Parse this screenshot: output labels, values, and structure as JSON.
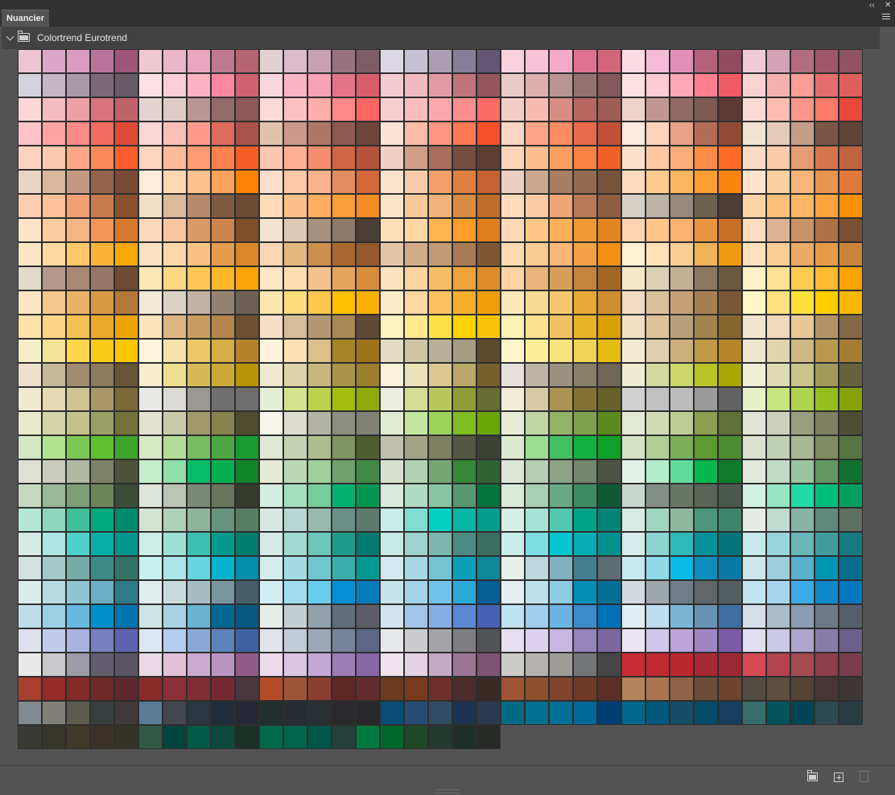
{
  "panel": {
    "tab_label": "Nuancier",
    "collapse_glyph": "‹‹",
    "close_glyph": "✕",
    "group_label": "Colortrend Eurotrend"
  },
  "icons": {
    "collapse": "double-chevron-left-icon",
    "close": "close-icon",
    "menu": "panel-menu-icon",
    "group_toggle": "chevron-down-icon",
    "group_folder": "folder-icon",
    "new_group": "new-folder-icon",
    "new_swatch": "new-swatch-icon",
    "delete": "trash-icon"
  },
  "swatches": [
    [
      "#ecc4d2",
      "#dca7c6",
      "#d99bc1",
      "#b8739a",
      "#9e5578",
      "#f0c8d2",
      "#e9b7c9",
      "#e8a6bf",
      "#c17891",
      "#b6646f",
      "#e3d0d3",
      "#dcbccb",
      "#c7a2b3",
      "#99727f",
      "#7d5c67",
      "#dcd8e3",
      "#c7c1d6",
      "#aa9db5",
      "#867d99",
      "#635674",
      "#fad2de",
      "#fbc2d7",
      "#f4abc9",
      "#de7391",
      "#d16579",
      "#fbdbe4",
      "#f6bcd5",
      "#e28eb7",
      "#b4627b",
      "#914c60",
      "#f0cad7",
      "#d3a2b4",
      "#b36c80",
      "#9f5669",
      "#8e5260"
    ],
    [
      "#d4d2db",
      "#c3b7c3",
      "#a79aa6",
      "#7a6a78",
      "#685b67",
      "#fde1e6",
      "#fbcdd7",
      "#fdb3c4",
      "#fb889f",
      "#cf6171",
      "#fbd6de",
      "#fbb5c6",
      "#f6a2b6",
      "#e47388",
      "#d85d6a",
      "#f4cbd0",
      "#f1bac2",
      "#e39ba3",
      "#c1737a",
      "#94565c",
      "#e8cac7",
      "#dcaeac",
      "#b99494",
      "#967071",
      "#82585c",
      "#fee1e3",
      "#fdcbd5",
      "#fda9b8",
      "#fd8090",
      "#f05b63",
      "#f9d3d2",
      "#f3b2ad",
      "#fe9c96",
      "#e56e6c",
      "#e1605d"
    ],
    [
      "#fbd7da",
      "#f6bbc2",
      "#eda1a6",
      "#d7747c",
      "#c1626a",
      "#e5d3d2",
      "#dfcac7",
      "#b99594",
      "#936b6b",
      "#8c5957",
      "#fdd9d9",
      "#fdc1c1",
      "#feacac",
      "#fe8885",
      "#fe6663",
      "#f4cfcf",
      "#f9bcbd",
      "#fba7ac",
      "#fc8e8f",
      "#fa6b67",
      "#f3cdc6",
      "#f7bbb1",
      "#d88c85",
      "#b86661",
      "#9e5d55",
      "#eed3cb",
      "#bf9991",
      "#916a63",
      "#7d5b53",
      "#5d3a34",
      "#fcdad4",
      "#fcbcb0",
      "#fd968a",
      "#fb7a68",
      "#e8493a"
    ],
    [
      "#fdc3c6",
      "#fea3a3",
      "#fb8a86",
      "#f26c5f",
      "#e04c38",
      "#fcd6d4",
      "#fabfb8",
      "#fe9b8d",
      "#de6b5e",
      "#a9534b",
      "#e0c2ac",
      "#cc9a8c",
      "#ad7868",
      "#8e5a50",
      "#6e443b",
      "#fde3d5",
      "#fdbca8",
      "#fd967f",
      "#fd7956",
      "#f44e2a",
      "#fdd5c5",
      "#fea588",
      "#fd8b63",
      "#e96a48",
      "#c25038",
      "#feeadf",
      "#fdd2bd",
      "#e9a288",
      "#b56c56",
      "#944b36",
      "#f2e2d2",
      "#e4cab9",
      "#c39e89",
      "#7b5647",
      "#5f4336"
    ],
    [
      "#fdd2bf",
      "#fec8ac",
      "#fea788",
      "#fb8a5a",
      "#fc5d2f",
      "#fed4bf",
      "#fdbb99",
      "#fd9c73",
      "#fe824d",
      "#f65e28",
      "#fec6af",
      "#fdad90",
      "#f28e6d",
      "#d06545",
      "#b5523b",
      "#efd0c2",
      "#d19c88",
      "#a86d5b",
      "#774d3f",
      "#5c3e33",
      "#fdd4b7",
      "#fdbd8e",
      "#fc9e61",
      "#f88342",
      "#f16125",
      "#fbe0cc",
      "#fdc7a4",
      "#fdad7a",
      "#fe8c46",
      "#fb6b24",
      "#fcdbc6",
      "#fdcaaa",
      "#e49d73",
      "#d6744b",
      "#c06241"
    ],
    [
      "#ead5c4",
      "#dbb7a0",
      "#c49984",
      "#94634c",
      "#7a4a36",
      "#feebd9",
      "#fdd7b2",
      "#fdc08f",
      "#fda15b",
      "#fd8103",
      "#fcdecf",
      "#fec8a8",
      "#f9b38b",
      "#e28d5e",
      "#d3683a",
      "#fce3cd",
      "#f8ccaa",
      "#f29f68",
      "#e07f3e",
      "#c46231",
      "#e9d0c0",
      "#cba78f",
      "#a77d63",
      "#936a50",
      "#7a533c",
      "#fedbbe",
      "#fdcb8c",
      "#fdb660",
      "#fd9e31",
      "#fd8410",
      "#fee4cf",
      "#fdcf9f",
      "#f7b57a",
      "#ea944e",
      "#df7839"
    ],
    [
      "#fdceb1",
      "#fdc19a",
      "#f1a072",
      "#c87a4f",
      "#8b4f2e",
      "#f2dfc7",
      "#d9bb9b",
      "#b58b6c",
      "#7e5a41",
      "#6c4a33",
      "#fedab9",
      "#fec089",
      "#fdae61",
      "#f99d3b",
      "#f38c24",
      "#fce4cd",
      "#f9ca97",
      "#f2b379",
      "#d98b3f",
      "#bf6c2a",
      "#fddbbb",
      "#fcc9a2",
      "#f0a575",
      "#b87b55",
      "#8e5f41",
      "#d6d0c4",
      "#bdb4a5",
      "#958a7c",
      "#6d6150",
      "#4b3f36",
      "#fdd3a4",
      "#fdc07c",
      "#fdb764",
      "#fda53c",
      "#fd9006"
    ],
    [
      "#fee5c9",
      "#fdcba0",
      "#f8b584",
      "#f19657",
      "#d6792f",
      "#fed8bb",
      "#f9c6a1",
      "#d89a69",
      "#cd844d",
      "#804f2a",
      "#f4e2d0",
      "#dec9b4",
      "#a69080",
      "#8d7a6a",
      "#4b3f36",
      "#fedfb8",
      "#fed7a4",
      "#ffb452",
      "#fe9e28",
      "#e07e1b",
      "#fdd8b6",
      "#fdc686",
      "#fbb25a",
      "#f09a35",
      "#e28420",
      "#fed4b0",
      "#fec48a",
      "#fbb170",
      "#e99443",
      "#c86f26",
      "#fddcc0",
      "#dcb495",
      "#c99266",
      "#ad7246",
      "#7b4f31"
    ],
    [
      "#fbe7c5",
      "#fcd9a0",
      "#fec86a",
      "#fcb239",
      "#fca807",
      "#fee2c4",
      "#fdd7a8",
      "#fbc382",
      "#e59c4d",
      "#d9892a",
      "#f9d5b3",
      "#e5b67f",
      "#ca8e4d",
      "#a8682f",
      "#95592d",
      "#e2c5a6",
      "#d2ac88",
      "#c29a73",
      "#a97b55",
      "#7f5833",
      "#fedab0",
      "#fbc992",
      "#f9b677",
      "#f4a148",
      "#f49013",
      "#fef0d4",
      "#fde2b9",
      "#f8ce94",
      "#f0b356",
      "#f19c0e",
      "#fde0bc",
      "#fdcb96",
      "#e9ab65",
      "#e69b48",
      "#c98638"
    ],
    [
      "#e3d9c8",
      "#b4998a",
      "#a78873",
      "#967566",
      "#6f4c34",
      "#fde8b8",
      "#fdd784",
      "#fec755",
      "#feb62b",
      "#fca30b",
      "#fee7c5",
      "#fedeb0",
      "#f4c48e",
      "#e7a45e",
      "#d88d3d",
      "#fde4be",
      "#fdd49f",
      "#f8bd67",
      "#f0a13a",
      "#db8b28",
      "#fdd3a3",
      "#e8b47c",
      "#d79e5b",
      "#c4843c",
      "#a36826",
      "#f7e7ca",
      "#dad0b6",
      "#c2b195",
      "#8c7861",
      "#6b5841",
      "#fff1c7",
      "#fee294",
      "#ffcb51",
      "#ffba31",
      "#fea305"
    ],
    [
      "#fee6c4",
      "#f6c68e",
      "#e8b365",
      "#d99942",
      "#b47939",
      "#f2e9d7",
      "#dad3c4",
      "#c2b2a3",
      "#958372",
      "#6d6156",
      "#fde7ae",
      "#fddc7b",
      "#fec64b",
      "#ffc004",
      "#fcb003",
      "#feebc7",
      "#fdd7a2",
      "#fec15f",
      "#fab02b",
      "#f29e0a",
      "#fde9b8",
      "#f9da92",
      "#f4c86e",
      "#e7a734",
      "#ce8e2d",
      "#f0dac3",
      "#d8bf9b",
      "#c6a177",
      "#a68053",
      "#7b5936",
      "#fef6c7",
      "#fee17e",
      "#fee03b",
      "#fece03",
      "#fdb704"
    ],
    [
      "#fde2aa",
      "#fcd588",
      "#f5c152",
      "#eca929",
      "#eea604",
      "#fde5bb",
      "#deb682",
      "#c99c61",
      "#b2864c",
      "#6d5132",
      "#f4dfc6",
      "#d4bd98",
      "#b29772",
      "#a88854",
      "#604a35",
      "#fdf1bf",
      "#fee98d",
      "#fee048",
      "#fed303",
      "#fcc207",
      "#fef1b4",
      "#fce191",
      "#eec262",
      "#e9b329",
      "#d9a007",
      "#f0dfc3",
      "#dec39a",
      "#b8a07a",
      "#a1854f",
      "#86662f",
      "#f2e4d0",
      "#efd9ba",
      "#e8c896",
      "#b39266",
      "#826845"
    ],
    [
      "#f7efc8",
      "#f2e396",
      "#fed74d",
      "#fdca1b",
      "#fec704",
      "#fdf4dc",
      "#f6e3ac",
      "#ebc767",
      "#d4ae45",
      "#b4822d",
      "#fef3dc",
      "#fce2b2",
      "#dbc089",
      "#a78428",
      "#9e741b",
      "#e3dbc3",
      "#cec3a5",
      "#b8b19a",
      "#a59c84",
      "#5d4b30",
      "#fef5c8",
      "#fdee99",
      "#f6e37b",
      "#f0d455",
      "#e2bb13",
      "#f3ead2",
      "#dfcfb0",
      "#cdaf7c",
      "#c09a44",
      "#b48629",
      "#ede6cf",
      "#e0d4ad",
      "#cfb883",
      "#b8994f",
      "#a47c36"
    ],
    [
      "#ede1cd",
      "#c8b89c",
      "#9f8b70",
      "#8d7a5d",
      "#675535",
      "#f5edcd",
      "#ece08e",
      "#d7b957",
      "#cca937",
      "#b89305",
      "#f0e9d1",
      "#ddd1a8",
      "#c6b77c",
      "#a99349",
      "#9a7f2c",
      "#faf2d8",
      "#ebe1b8",
      "#dbc78f",
      "#baa966",
      "#76612a",
      "#e6e1dc",
      "#bdb4a6",
      "#9b9180",
      "#888068",
      "#716558",
      "#edebd2",
      "#d3d99c",
      "#cbd769",
      "#b9c226",
      "#a8a705",
      "#f1efd8",
      "#dedbb3",
      "#c9c58a",
      "#a19b5b",
      "#66623d"
    ],
    [
      "#f1e9d2",
      "#e6d9b3",
      "#d0c293",
      "#a99665",
      "#7c6838",
      "#e8e8e7",
      "#dbdad5",
      "#9b9893",
      "#717071",
      "#6e6e6e",
      "#e5efd5",
      "#d5e48a",
      "#bbd24c",
      "#a3be0a",
      "#90a80a",
      "#ecefe0",
      "#d5dd95",
      "#b9c75f",
      "#8f9c38",
      "#666d32",
      "#f1edd8",
      "#d8c9a4",
      "#ab9452",
      "#847235",
      "#66612b",
      "#d1d1d1",
      "#c0c0c0",
      "#bbbbbb",
      "#9a9a9a",
      "#626262",
      "#e7f1c6",
      "#c7e581",
      "#afd44e",
      "#97be20",
      "#86a10b"
    ],
    [
      "#e9e9cc",
      "#d3d4a8",
      "#c3c08a",
      "#99a064",
      "#72723a",
      "#e3e2cf",
      "#cac9a9",
      "#a09a6b",
      "#86824d",
      "#4d4c2e",
      "#f6f5e8",
      "#dcdcd0",
      "#b2b2a5",
      "#8c8e80",
      "#818177",
      "#e1edd1",
      "#c4e5a0",
      "#9ad35a",
      "#7ebe24",
      "#6aa706",
      "#e9ecd6",
      "#bfd6a2",
      "#93b468",
      "#7ea24c",
      "#5d8a1c",
      "#e4e9d4",
      "#d0dbb6",
      "#bdcc94",
      "#8d9d52",
      "#5f7138",
      "#e2e4d5",
      "#cdd1bc",
      "#9a9d7d",
      "#7d7f60",
      "#4d4d35"
    ],
    [
      "#d1e8c2",
      "#b0e38f",
      "#7dc854",
      "#5ec130",
      "#40a42b",
      "#d6e8c4",
      "#b3dc99",
      "#78bc62",
      "#4aa742",
      "#189c2f",
      "#e0e8d6",
      "#c5d2b2",
      "#aebd90",
      "#819462",
      "#505d30",
      "#c1c0ad",
      "#a3a287",
      "#7e7f60",
      "#545742",
      "#3b4133",
      "#dbe9ce",
      "#99dd91",
      "#41bf61",
      "#12b140",
      "#0ea127",
      "#d5e3c4",
      "#b2cd96",
      "#7cad58",
      "#5c9a33",
      "#4d8c33",
      "#dae2cf",
      "#c1cfb2",
      "#a8b794",
      "#7e8b63",
      "#557441"
    ],
    [
      "#dfe0d3",
      "#c9ccbb",
      "#b1b8a1",
      "#7d8266",
      "#4c533a",
      "#c4edc9",
      "#8fdfaa",
      "#03be66",
      "#06b04e",
      "#12842a",
      "#e6ebd8",
      "#bcd9b5",
      "#a0cf9c",
      "#6ea26a",
      "#438946",
      "#d5e1cd",
      "#b1d1b3",
      "#75a775",
      "#37863a",
      "#2f6432",
      "#dbe6d6",
      "#b5ccb0",
      "#8ba285",
      "#74866b",
      "#4c5343",
      "#e1f3e5",
      "#b3edcb",
      "#5edb9b",
      "#06b64f",
      "#0d7d2b",
      "#e1e9db",
      "#c1dac6",
      "#9bc3a0",
      "#609862",
      "#117030"
    ],
    [
      "#c5d9c1",
      "#9ab996",
      "#7d9d77",
      "#6a8658",
      "#3d4c36",
      "#dde6da",
      "#bac5b6",
      "#7b8874",
      "#68745c",
      "#353c2c",
      "#d5ede0",
      "#a3dfbf",
      "#74cd9b",
      "#05b06f",
      "#059751",
      "#d7eadb",
      "#b1dac2",
      "#86c6a2",
      "#589871",
      "#06733b",
      "#d9ebd8",
      "#a8cfb2",
      "#6ba884",
      "#3d8d62",
      "#0e5933",
      "#c5d6cc",
      "#848f87",
      "#6a7766",
      "#5a6557",
      "#4b5a4c",
      "#d1f1e2",
      "#94e6c5",
      "#21d9a3",
      "#05bd7b",
      "#049f5e"
    ],
    [
      "#b5e6d6",
      "#8ed7be",
      "#40bf9a",
      "#03aa7c",
      "#00896a",
      "#d3e3d2",
      "#aed0b8",
      "#8fb39c",
      "#68937c",
      "#587f62",
      "#d6e7e2",
      "#b9d7d2",
      "#9ab9ae",
      "#6a8f87",
      "#5d7b6f",
      "#c8ece7",
      "#7fddd1",
      "#03d1c5",
      "#07b6a4",
      "#009d8c",
      "#d6efe7",
      "#a5e2d6",
      "#54c8af",
      "#01a486",
      "#048374",
      "#d7ece4",
      "#a0d6c1",
      "#90b8a1",
      "#4d957b",
      "#3f846c",
      "#e4ece5",
      "#bedccf",
      "#88b4a6",
      "#5d8a7b",
      "#5e7060"
    ],
    [
      "#d7ebe6",
      "#abe6e1",
      "#4ed1cd",
      "#03afa7",
      "#01958d",
      "#cdeee7",
      "#9ee0d6",
      "#3dc0b3",
      "#01998b",
      "#007d6c",
      "#d5e9e7",
      "#9edacf",
      "#6bc7bb",
      "#1f9b8b",
      "#007b6d",
      "#c7e8e4",
      "#9ed2cc",
      "#7cb6ac",
      "#4c8a83",
      "#3d6f62",
      "#c9ede8",
      "#7cdde2",
      "#03c6d0",
      "#04acb3",
      "#00918e",
      "#d6ecea",
      "#8dd3d0",
      "#2fb8b8",
      "#06929b",
      "#04757b",
      "#c5e8ea",
      "#96d5d9",
      "#68b6b8",
      "#3e9c9c",
      "#157b7e"
    ],
    [
      "#d1e1e0",
      "#a3cac8",
      "#76aca8",
      "#3c8b86",
      "#357367",
      "#c7f0ef",
      "#ace4ea",
      "#65d4df",
      "#04b4cd",
      "#038dad",
      "#d4edec",
      "#a5dce4",
      "#6ec7cf",
      "#3aaeae",
      "#039890",
      "#d2eaef",
      "#a6d8e3",
      "#73c4d3",
      "#0b9fb8",
      "#0e8897",
      "#e7f0ea",
      "#bcd8dc",
      "#83b0bf",
      "#437f8e",
      "#5c6d74",
      "#c7eaee",
      "#8fd9e9",
      "#06bbe4",
      "#0c8dbd",
      "#0879a5",
      "#cde6ea",
      "#9bcdda",
      "#5ab1cb",
      "#0094b2",
      "#096d8d"
    ],
    [
      "#dbeced",
      "#b7dae1",
      "#90c5d4",
      "#6aafc3",
      "#2f7a86",
      "#e0eeed",
      "#c8dcdd",
      "#a6bdc2",
      "#7895a0",
      "#465e6a",
      "#d3eff4",
      "#a1dcf1",
      "#68cdee",
      "#0391d6",
      "#067bbb",
      "#c7e3ea",
      "#a4d3e7",
      "#70c4e9",
      "#2ba9d7",
      "#045e93",
      "#e3eff0",
      "#bce1ec",
      "#8ccde3",
      "#068eb9",
      "#056e96",
      "#d3d9dc",
      "#9ea8ac",
      "#6f7e86",
      "#5e6769",
      "#545e61",
      "#c0e5f0",
      "#a8d3ef",
      "#3bace5",
      "#0e88cb",
      "#0277bd"
    ],
    [
      "#bedeeb",
      "#9ad0e3",
      "#68b9df",
      "#0090c9",
      "#0173af",
      "#cee3e4",
      "#a9d2e3",
      "#68b2d2",
      "#006991",
      "#075982",
      "#e7eee8",
      "#c5ced1",
      "#91a2ad",
      "#606e7b",
      "#5c5d66",
      "#d3e4ef",
      "#a2c6e7",
      "#85aee5",
      "#5b88d3",
      "#4461b5",
      "#c0e1ef",
      "#9fcdea",
      "#6db3e2",
      "#3c8bcb",
      "#0071b7",
      "#e1eff4",
      "#c0ddef",
      "#7ab5d6",
      "#6791b3",
      "#3c6ea2",
      "#d5dfe8",
      "#abbcca",
      "#8b9cb3",
      "#6d7888",
      "#555f6b"
    ],
    [
      "#e0e1ee",
      "#c3cbec",
      "#aab2e0",
      "#7780c0",
      "#5d62ae",
      "#dae8f3",
      "#b5cdef",
      "#8aa9d8",
      "#5d81bd",
      "#3f61a0",
      "#e0e4e8",
      "#c3cbd6",
      "#9ea8b9",
      "#76849b",
      "#5b6784",
      "#e6e8ea",
      "#cbcccf",
      "#a4a4a9",
      "#7f7d84",
      "#525357",
      "#e6e0f1",
      "#dcd1ee",
      "#c7b7e0",
      "#9485bd",
      "#7d67a0",
      "#ece6f4",
      "#d0c6ea",
      "#bba5d8",
      "#9f85c3",
      "#7c5ba6",
      "#e1def0",
      "#cbc9e6",
      "#aea5cc",
      "#887daa",
      "#6b5e8a"
    ],
    [
      "#e9e9e9",
      "#c9c9cd",
      "#9d9ba6",
      "#625e6d",
      "#5a5463",
      "#ebd8e5",
      "#e1c0d8",
      "#ccabd3",
      "#ba94c0",
      "#905a89",
      "#ecdaea",
      "#dbc5e2",
      "#c5a9d5",
      "#9e7cb6",
      "#8966a6",
      "#efe3ee",
      "#e4d1e3",
      "#c6a9c6",
      "#9b7594",
      "#7d5473",
      "#cccbc8",
      "#b4b2ae",
      "#9f9c97",
      "#747576",
      "#464646",
      "#c62d34",
      "#c02832",
      "#bd282f",
      "#a72834",
      "#9c2732",
      "#d84955",
      "#b4424e",
      "#a44a50",
      "#8d3d4b",
      "#793d4e"
    ],
    [
      "#a8402f",
      "#952b27",
      "#822a27",
      "#6e2a25",
      "#5f2830",
      "#872c2b",
      "#8c2f39",
      "#812d34",
      "#742a30",
      "#4a363c",
      "#b34a28",
      "#9e5237",
      "#8a4030",
      "#5f2823",
      "#622b2d",
      "#6c3a1e",
      "#7a391f",
      "#6f302a",
      "#4b2c2a",
      "#3a2a26",
      "#9e5332",
      "#8d4f2c",
      "#80442c",
      "#703926",
      "#5c2f26",
      "#b4825a",
      "#a87552",
      "#8f6349",
      "#6d4e3b",
      "#6e4431",
      "#524b41",
      "#5d4e3f",
      "#544232",
      "#463734",
      "#3f3736"
    ],
    [
      "#818a8f",
      "#808079",
      "#5d5b4f",
      "#393e3e",
      "#413839",
      "#5a7c96",
      "#44474e",
      "#2a3640",
      "#1f2d3c",
      "#252834",
      "#20302e",
      "#252c32",
      "#2b3034",
      "#2a2a2c",
      "#262829",
      "#084d74",
      "#264c75",
      "#324b64",
      "#1c3452",
      "#2a3a50",
      "#006a85",
      "#006f92",
      "#006f94",
      "#01689a",
      "#003d73",
      "#02678c",
      "#05587b",
      "#164d67",
      "#074b6b",
      "#153f5c",
      "#376d6c",
      "#01545d",
      "#004457",
      "#2d4a52",
      "#283c44"
    ],
    [
      "#383b33",
      "#35352a",
      "#403a2b",
      "#3a3229",
      "#353227",
      "#2f5844",
      "#00443b",
      "#015a46",
      "#0b4a3b",
      "#1a3127",
      "#006a4a",
      "#006549",
      "#005648",
      "#25403a",
      "#007940",
      "#00682b",
      "#1f4828",
      "#233a30",
      "#1f2e26",
      "#282a27"
    ]
  ]
}
